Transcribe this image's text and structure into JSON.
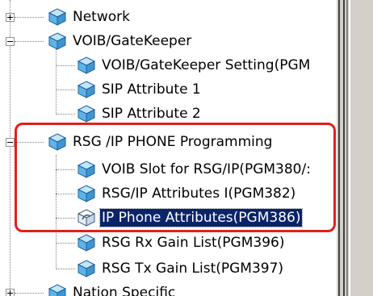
{
  "tree": {
    "items": [
      {
        "label": "Network",
        "level": 0,
        "expander": "plus",
        "icon": "cube-icon"
      },
      {
        "label": "VOIB/GateKeeper",
        "level": 0,
        "expander": "minus",
        "icon": "cube-icon"
      },
      {
        "label": "VOIB/GateKeeper Setting(PGM",
        "level": 1,
        "icon": "cube-icon"
      },
      {
        "label": "SIP Attribute 1",
        "level": 1,
        "icon": "cube-icon"
      },
      {
        "label": "SIP Attribute 2",
        "level": 1,
        "icon": "cube-icon"
      },
      {
        "label": "RSG /IP PHONE Programming",
        "level": 0,
        "expander": "minus",
        "icon": "cube-icon"
      },
      {
        "label": "VOIB Slot for RSG/IP(PGM380/:",
        "level": 1,
        "icon": "cube-icon"
      },
      {
        "label": "RSG/IP Attributes I(PGM382)",
        "level": 1,
        "icon": "cube-icon"
      },
      {
        "label": "IP Phone Attributes(PGM386)",
        "level": 1,
        "icon": "cube-open-icon",
        "selected": true
      },
      {
        "label": "RSG Rx Gain List(PGM396)",
        "level": 1,
        "icon": "cube-icon"
      },
      {
        "label": "RSG Tx Gain List(PGM397)",
        "level": 1,
        "icon": "cube-icon"
      },
      {
        "label": "Nation Specific",
        "level": 0,
        "expander": "plus",
        "icon": "cube-icon"
      }
    ]
  },
  "colors": {
    "cube_fill": "#5fb4e6",
    "cube_top": "#bfe6fb",
    "cube_edge": "#1f5f9e",
    "selection": "#0a246a",
    "highlight_border": "#e0201c"
  }
}
